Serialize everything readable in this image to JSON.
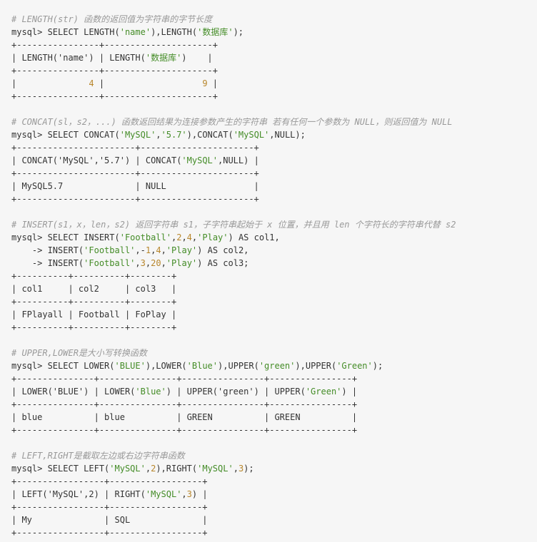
{
  "colors": {
    "background": "#f6f6f6",
    "plain": "#333333",
    "comment": "#999999",
    "string": "#448c27",
    "number": "#b8862b"
  },
  "code_block": {
    "language": "sql",
    "lines": [
      [
        [
          "comment",
          "# LENGTH(str) 函数的返回值为字符串的字节长度"
        ]
      ],
      [
        [
          "plain",
          "mysql> SELECT LENGTH("
        ],
        [
          "string",
          "'name'"
        ],
        [
          "plain",
          "),LENGTH("
        ],
        [
          "string",
          "'数据库'"
        ],
        [
          "plain",
          ");"
        ]
      ],
      [
        [
          "plain",
          "+----------------+---------------------+"
        ]
      ],
      [
        [
          "plain",
          "| LENGTH('name') | LENGTH("
        ],
        [
          "string",
          "'数据库'"
        ],
        [
          "plain",
          ")    |"
        ]
      ],
      [
        [
          "plain",
          "+----------------+---------------------+"
        ]
      ],
      [
        [
          "plain",
          "|              "
        ],
        [
          "number",
          "4"
        ],
        [
          "plain",
          " |                   "
        ],
        [
          "number",
          "9"
        ],
        [
          "plain",
          " |"
        ]
      ],
      [
        [
          "plain",
          "+----------------+---------------------+"
        ]
      ],
      [
        [
          "plain",
          ""
        ]
      ],
      [
        [
          "comment",
          "# CONCAT(sl，s2，...) 函数返回结果为连接参数产生的字符串 若有任何一个参数为 NULL，则返回值为 NULL"
        ]
      ],
      [
        [
          "plain",
          "mysql> SELECT CONCAT("
        ],
        [
          "string",
          "'MySQL'"
        ],
        [
          "plain",
          ","
        ],
        [
          "string",
          "'5.7'"
        ],
        [
          "plain",
          "),CONCAT("
        ],
        [
          "string",
          "'MySQL'"
        ],
        [
          "plain",
          ",NULL);"
        ]
      ],
      [
        [
          "plain",
          "+-----------------------+----------------------+"
        ]
      ],
      [
        [
          "plain",
          "| CONCAT('MySQL','5.7') | CONCAT("
        ],
        [
          "string",
          "'MySQL'"
        ],
        [
          "plain",
          ",NULL) |"
        ]
      ],
      [
        [
          "plain",
          "+-----------------------+----------------------+"
        ]
      ],
      [
        [
          "plain",
          "| MySQL5.7              | NULL                 |"
        ]
      ],
      [
        [
          "plain",
          "+-----------------------+----------------------+"
        ]
      ],
      [
        [
          "plain",
          ""
        ]
      ],
      [
        [
          "comment",
          "# INSERT(s1，x，len，s2) 返回字符串 s1，子字符串起始于 x 位置，并且用 len 个字符长的字符串代替 s2"
        ]
      ],
      [
        [
          "plain",
          "mysql> SELECT INSERT("
        ],
        [
          "string",
          "'Football'"
        ],
        [
          "plain",
          ","
        ],
        [
          "number",
          "2"
        ],
        [
          "plain",
          ","
        ],
        [
          "number",
          "4"
        ],
        [
          "plain",
          ","
        ],
        [
          "string",
          "'Play'"
        ],
        [
          "plain",
          ") AS col1,"
        ]
      ],
      [
        [
          "plain",
          "    -> INSERT("
        ],
        [
          "string",
          "'Football'"
        ],
        [
          "plain",
          ",-"
        ],
        [
          "number",
          "1"
        ],
        [
          "plain",
          ","
        ],
        [
          "number",
          "4"
        ],
        [
          "plain",
          ","
        ],
        [
          "string",
          "'Play'"
        ],
        [
          "plain",
          ") AS col2,"
        ]
      ],
      [
        [
          "plain",
          "    -> INSERT("
        ],
        [
          "string",
          "'Football'"
        ],
        [
          "plain",
          ","
        ],
        [
          "number",
          "3"
        ],
        [
          "plain",
          ","
        ],
        [
          "number",
          "20"
        ],
        [
          "plain",
          ","
        ],
        [
          "string",
          "'Play'"
        ],
        [
          "plain",
          ") AS col3;"
        ]
      ],
      [
        [
          "plain",
          "+----------+----------+--------+"
        ]
      ],
      [
        [
          "plain",
          "| col1     | col2     | col3   |"
        ]
      ],
      [
        [
          "plain",
          "+----------+----------+--------+"
        ]
      ],
      [
        [
          "plain",
          "| FPlayall | Football | FoPlay |"
        ]
      ],
      [
        [
          "plain",
          "+----------+----------+--------+"
        ]
      ],
      [
        [
          "plain",
          ""
        ]
      ],
      [
        [
          "comment",
          "# UPPER,LOWER是大小写转换函数"
        ]
      ],
      [
        [
          "plain",
          "mysql> SELECT LOWER("
        ],
        [
          "string",
          "'BLUE'"
        ],
        [
          "plain",
          "),LOWER("
        ],
        [
          "string",
          "'Blue'"
        ],
        [
          "plain",
          "),UPPER("
        ],
        [
          "string",
          "'green'"
        ],
        [
          "plain",
          "),UPPER("
        ],
        [
          "string",
          "'Green'"
        ],
        [
          "plain",
          ");"
        ]
      ],
      [
        [
          "plain",
          "+---------------+---------------+----------------+----------------+"
        ]
      ],
      [
        [
          "plain",
          "| LOWER('BLUE') | LOWER("
        ],
        [
          "string",
          "'Blue'"
        ],
        [
          "plain",
          ") | UPPER('green') | UPPER("
        ],
        [
          "string",
          "'Green'"
        ],
        [
          "plain",
          ") |"
        ]
      ],
      [
        [
          "plain",
          "+---------------+---------------+----------------+----------------+"
        ]
      ],
      [
        [
          "plain",
          "| blue          | blue          | GREEN          | GREEN          |"
        ]
      ],
      [
        [
          "plain",
          "+---------------+---------------+----------------+----------------+"
        ]
      ],
      [
        [
          "plain",
          ""
        ]
      ],
      [
        [
          "comment",
          "# LEFT,RIGHT是截取左边或右边字符串函数"
        ]
      ],
      [
        [
          "plain",
          "mysql> SELECT LEFT("
        ],
        [
          "string",
          "'MySQL'"
        ],
        [
          "plain",
          ","
        ],
        [
          "number",
          "2"
        ],
        [
          "plain",
          "),RIGHT("
        ],
        [
          "string",
          "'MySQL'"
        ],
        [
          "plain",
          ","
        ],
        [
          "number",
          "3"
        ],
        [
          "plain",
          ");"
        ]
      ],
      [
        [
          "plain",
          "+-----------------+------------------+"
        ]
      ],
      [
        [
          "plain",
          "| LEFT('MySQL',2) | RIGHT("
        ],
        [
          "string",
          "'MySQL'"
        ],
        [
          "plain",
          ","
        ],
        [
          "number",
          "3"
        ],
        [
          "plain",
          ") |"
        ]
      ],
      [
        [
          "plain",
          "+-----------------+------------------+"
        ]
      ],
      [
        [
          "plain",
          "| My              | SQL              |"
        ]
      ],
      [
        [
          "plain",
          "+-----------------+------------------+"
        ]
      ]
    ]
  }
}
